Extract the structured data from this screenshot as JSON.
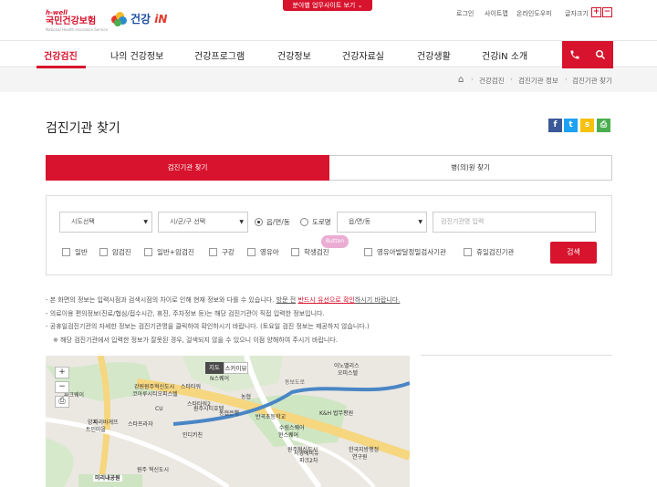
{
  "header": {
    "logo_main_top": "h-well",
    "logo_main": "국민건강보험",
    "logo_main_sub": "National Health Insurance Service",
    "logo_second": "건강",
    "logo_second_accent": "iN",
    "site_button": "분야별 업무사이트 보기",
    "util_links": [
      "로그인",
      "사이트맵",
      "온라인도우미",
      "글자크기"
    ],
    "font_plus": "+",
    "font_minus": "−"
  },
  "nav": {
    "items": [
      "건강검진",
      "나의 건강정보",
      "건강프로그램",
      "건강정보",
      "건강자료실",
      "건강생활",
      "건강iN 소개"
    ],
    "active_index": 0
  },
  "breadcrumb": [
    "건강검진",
    "검진기관 정보",
    "검진기관 찾기"
  ],
  "page": {
    "title": "검진기관 찾기",
    "share_icons": [
      "facebook-icon",
      "twitter-icon",
      "kakaostory-icon",
      "print-icon"
    ]
  },
  "tabs": [
    "검진기관 찾기",
    "병(의)원 찾기"
  ],
  "search": {
    "sido": "시도선택",
    "sigungu": "시/군/구 선택",
    "radio": [
      "읍/면/동",
      "도로명"
    ],
    "radio_selected": 0,
    "dong": "읍/면/동",
    "name_placeholder": "검진기관명 입력",
    "checkboxes": [
      "일반",
      "암검진",
      "일반+암검진",
      "구강",
      "영유아",
      "학생검진",
      "영유아발달정밀검사기관",
      "휴일검진기관"
    ],
    "submit": "검색",
    "cursor_tooltip": "Button"
  },
  "notes": {
    "line1_a": "- 본 화면의 정보는 입력시점과 검색시점의 차이로 인해 현재 정보와 다를 수 있습니다.",
    "line1_b": "방문 전",
    "line1_c": "반드시 유선으로 확인",
    "line1_d": "하시기 바랍니다.",
    "line2": "- 의료이용 편의정보(진료/협심/접수시간, 휴진, 주차정보 등)는 해당 검진기관이 직접 입력한 정보입니다.",
    "line3": "- 공휴일검진기관의 자세한 정보는 검진기관명을 클릭하여 확인하시기 바랍니다. (토요일 검진 정보는 제공하지 않습니다.)",
    "line4": "※ 해당 검진기관에서 입력한 정보가 잘못된 경우, 걸색되지 않을 수 있으니 이점 양해하여 주시기 바랍니다."
  },
  "map": {
    "type_buttons": [
      "지도",
      "스카이뷰"
    ],
    "zoom_in": "+",
    "zoom_out": "−",
    "labels": [
      "강원원주혁신도시",
      "코아루시티오피스텔",
      "스타타워",
      "원주시티호텔",
      "스타프라자",
      "파크웨이",
      "파리바게뜨",
      "인디키친",
      "반곡초등학교",
      "이노밸리스",
      "오피스텔",
      "원주혁신도시",
      "수림스퀘어",
      "서영에비뉴",
      "파크2차",
      "한국지방행정",
      "연구원",
      "미리내공원",
      "양지",
      "트인마을",
      "N스퀘어",
      "스타타워2",
      "CU",
      "농협은행",
      "현스퀘어",
      "K&H 법무평원",
      "동보도로",
      "원주 혁신도시",
      "농협"
    ]
  }
}
